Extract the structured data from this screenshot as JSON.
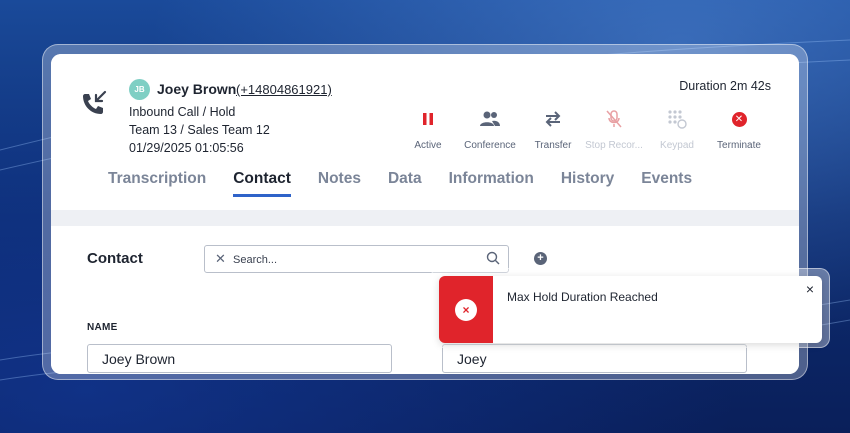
{
  "caller": {
    "initials": "JB",
    "name": "Joey Brown",
    "number": "(+14804861921)",
    "status": "Inbound Call / Hold",
    "team": "Team 13 / Sales Team 12",
    "datetime": "01/29/2025 01:05:56",
    "duration": "Duration 2m 42s"
  },
  "actions": [
    {
      "label": "Active",
      "icon": "pause-icon",
      "enabled": true
    },
    {
      "label": "Conference",
      "icon": "users-icon",
      "enabled": true
    },
    {
      "label": "Transfer",
      "icon": "transfer-arrows-icon",
      "enabled": true
    },
    {
      "label": "Stop Recor...",
      "icon": "mic-off-icon",
      "enabled": false
    },
    {
      "label": "Keypad",
      "icon": "keypad-icon",
      "enabled": false
    },
    {
      "label": "Terminate",
      "icon": "terminate-icon",
      "enabled": true
    }
  ],
  "tabs": [
    "Transcription",
    "Contact",
    "Notes",
    "Data",
    "Information",
    "History",
    "Events"
  ],
  "active_tab": "Contact",
  "contact": {
    "title": "Contact",
    "search_placeholder": "Search...",
    "name_label": "NAME",
    "full_name": "Joey Brown",
    "first_name": "Joey"
  },
  "toast": {
    "message": "Max Hold Duration Reached",
    "close": "×",
    "icon": "×"
  },
  "colors": {
    "accent": "#2f63c9",
    "danger": "#e0242b",
    "avatar": "#7fcfc4"
  }
}
